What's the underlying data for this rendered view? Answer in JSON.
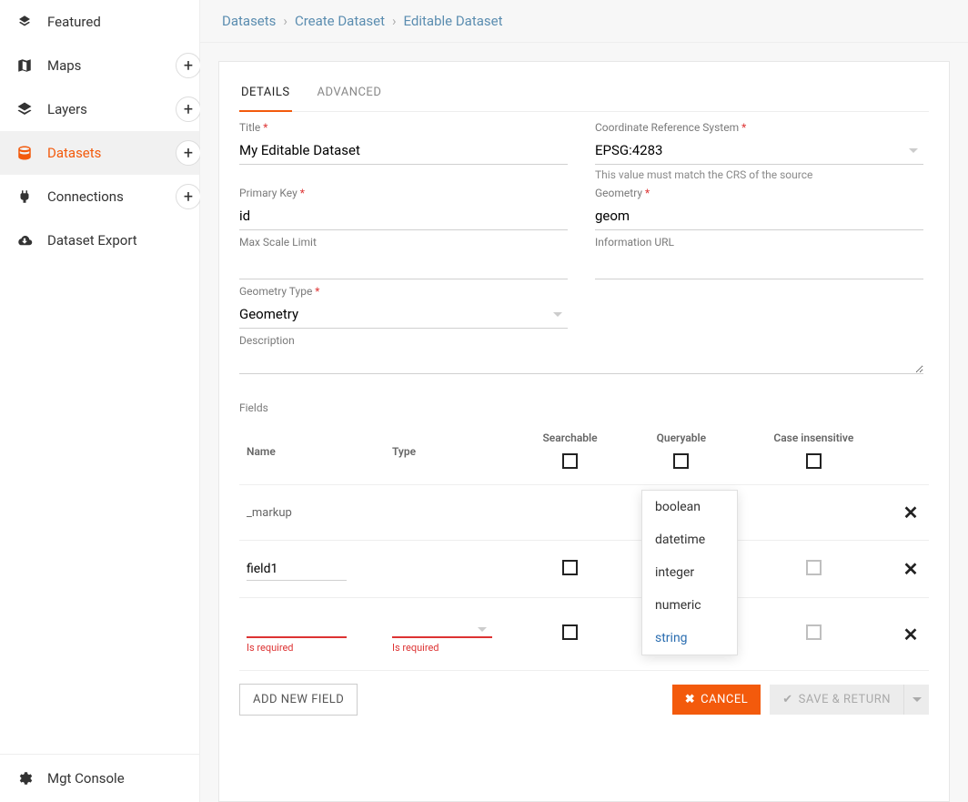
{
  "sidebar": {
    "items": [
      {
        "label": "Featured",
        "icon": "featured"
      },
      {
        "label": "Maps",
        "icon": "map",
        "add": true
      },
      {
        "label": "Layers",
        "icon": "layers",
        "add": true
      },
      {
        "label": "Datasets",
        "icon": "database",
        "add": true,
        "active": true
      },
      {
        "label": "Connections",
        "icon": "plug",
        "add": true
      },
      {
        "label": "Dataset Export",
        "icon": "cloud-down"
      }
    ],
    "footer": {
      "label": "Mgt Console",
      "icon": "gear"
    }
  },
  "breadcrumbs": [
    "Datasets",
    "Create Dataset",
    "Editable Dataset"
  ],
  "tabs": [
    {
      "label": "DETAILS",
      "active": true
    },
    {
      "label": "ADVANCED",
      "active": false
    }
  ],
  "form": {
    "title": {
      "label": "Title",
      "required": true,
      "value": "My Editable Dataset"
    },
    "crs": {
      "label": "Coordinate Reference System",
      "required": true,
      "value": "EPSG:4283",
      "hint": "This value must match the CRS of the source"
    },
    "pk": {
      "label": "Primary Key",
      "required": true,
      "value": "id"
    },
    "geom": {
      "label": "Geometry",
      "required": true,
      "value": "geom"
    },
    "maxscale": {
      "label": "Max Scale Limit",
      "value": ""
    },
    "infourl": {
      "label": "Information URL",
      "value": ""
    },
    "geomtype": {
      "label": "Geometry Type",
      "required": true,
      "value": "Geometry"
    },
    "description": {
      "label": "Description",
      "value": ""
    }
  },
  "fieldsSection": {
    "label": "Fields",
    "headers": {
      "name": "Name",
      "type": "Type",
      "searchable": "Searchable",
      "queryable": "Queryable",
      "caseins": "Case insensitive"
    },
    "rows": [
      {
        "name": "_markup",
        "readonly": true,
        "searchable": null,
        "queryable": null,
        "caseins": null,
        "remove": true
      },
      {
        "name": "field1",
        "readonly": false,
        "searchable": false,
        "queryable": false,
        "caseins_light": true,
        "remove": true
      },
      {
        "name": "",
        "readonly": false,
        "error": "Is required",
        "type_error": "Is required",
        "searchable": false,
        "queryable": false,
        "caseins_light": true,
        "remove": true
      }
    ],
    "headerSearchable": false,
    "headerQueryable": false,
    "headerCaseins": false
  },
  "typeOptions": [
    "boolean",
    "datetime",
    "integer",
    "numeric",
    "string"
  ],
  "typeSelected": "string",
  "actions": {
    "addField": "ADD NEW FIELD",
    "cancel": "CANCEL",
    "save": "SAVE & RETURN"
  }
}
